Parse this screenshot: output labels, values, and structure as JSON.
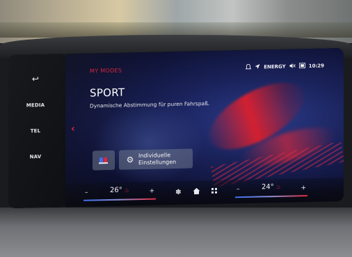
{
  "sidebar": {
    "back_icon": "↩",
    "items": [
      {
        "label": "MEDIA"
      },
      {
        "label": "TEL"
      },
      {
        "label": "NAV"
      }
    ]
  },
  "header": {
    "section": "MY MODES",
    "status": {
      "notification_icon": "bell-icon",
      "navigation_icon": "arrow-icon",
      "energy_label": "ENERGY",
      "mute_icon": "speaker-muted-icon",
      "screen_icon": "display-icon",
      "time": "10:29"
    }
  },
  "mode": {
    "title": "SPORT",
    "description": "Dynamische Abstimmung für puren Fahrspaß."
  },
  "tiles": {
    "individual_settings_line1": "Individuelle",
    "individual_settings_line2": "Einstellungen"
  },
  "climate": {
    "left_temp": "26°",
    "right_temp": "24°",
    "minus_label": "–",
    "plus_label": "+"
  },
  "colors": {
    "accent_red": "#d4213c",
    "text_white": "#f4f4f6"
  }
}
